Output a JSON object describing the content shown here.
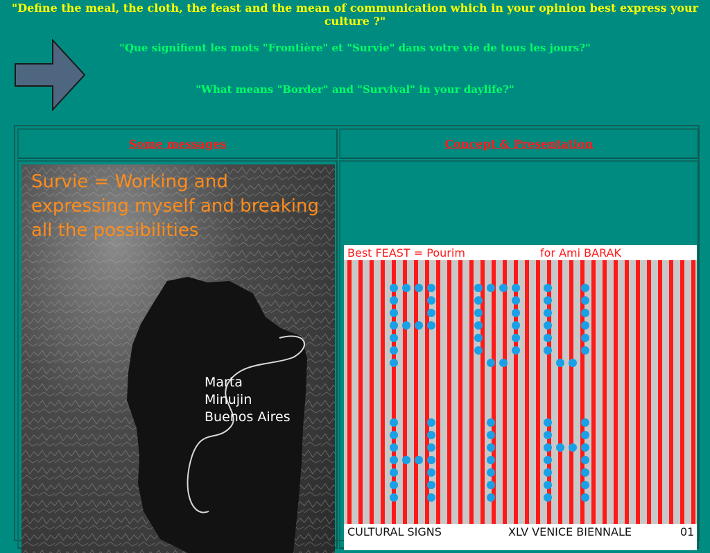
{
  "questions": {
    "q1": "\"Define the meal, the cloth, the feast and the mean of communication which in your opinion best express your culture ?\"",
    "q2": "\"Que signifient les mots \"Frontière\" et \"Survie\" dans votre vie de tous les jours?\"",
    "q3": "\"What means \"Border\" and \"Survival\" in your daylife?\""
  },
  "nav": {
    "arrow_icon": "right-arrow-icon",
    "links": [
      {
        "label": "Some messages"
      },
      {
        "label": "Concept & Presentation"
      }
    ]
  },
  "left_image": {
    "caption": "Survie = Working and expressing myself and breaking all the possibilities",
    "artist_lines": [
      "Marta",
      "Minujin",
      "Buenos Aires"
    ]
  },
  "right_image": {
    "top_left": "Best FEAST = Pourim",
    "top_right": "for Ami BARAK",
    "bottom_left": "CULTURAL SIGNS",
    "bottom_mid": "XLV VENICE BIENNALE",
    "bottom_right": "01"
  },
  "colors": {
    "background": "#008b80",
    "q1": "#ffff00",
    "q2": "#00ff66",
    "link": "#ff1a1a",
    "caption": "#ff8c1a"
  }
}
